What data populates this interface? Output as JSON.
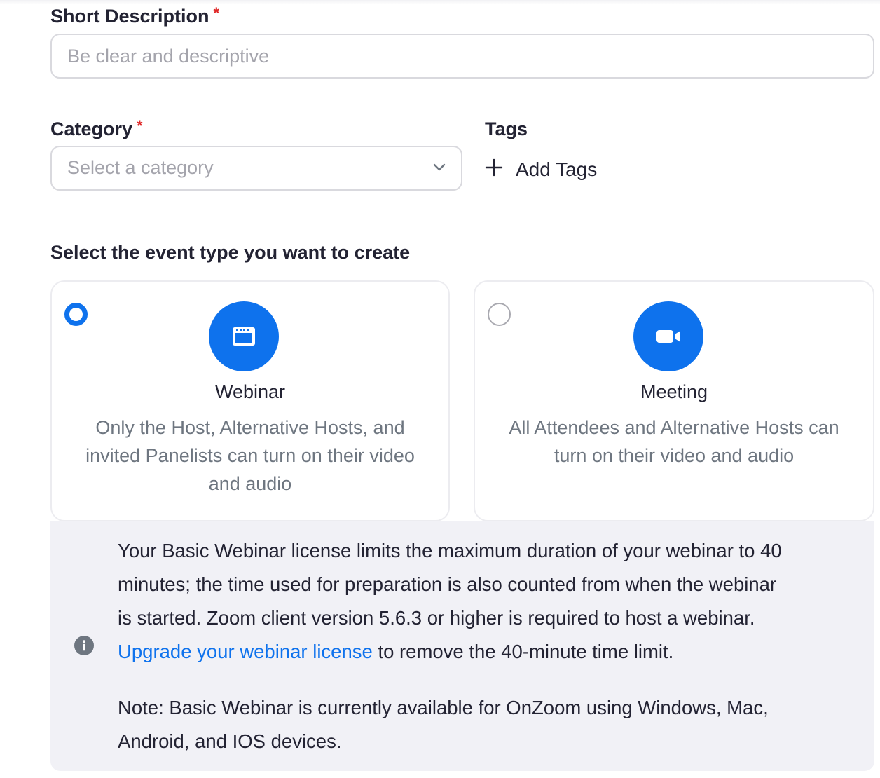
{
  "short_description": {
    "label": "Short Description",
    "required_mark": "*",
    "placeholder": "Be clear and descriptive",
    "value": ""
  },
  "category": {
    "label": "Category",
    "required_mark": "*",
    "placeholder": "Select a category",
    "icon": "chevron-down-icon"
  },
  "tags": {
    "label": "Tags",
    "add_label": "Add Tags",
    "icon": "plus-icon"
  },
  "event_type": {
    "heading": "Select the event type you want to create",
    "options": [
      {
        "title": "Webinar",
        "description_lines": [
          "Only the Host, Alternative Hosts, and",
          "invited Panelists can turn on their video",
          "and audio"
        ],
        "selected": true,
        "icon": "webinar-icon"
      },
      {
        "title": "Meeting",
        "description_lines": [
          "All Attendees and Alternative Hosts can",
          "turn on their video and audio"
        ],
        "selected": false,
        "icon": "video-camera-icon"
      }
    ]
  },
  "notice": {
    "icon": "info-icon",
    "lines": [
      "Your Basic Webinar license limits the maximum duration of your webinar to 40",
      "minutes; the time used for preparation is also counted from when the webinar",
      "is started. Zoom client version 5.6.3 or higher is required to host a webinar."
    ],
    "link_text": "Upgrade your webinar license",
    "after_link": " to remove the 40-minute time limit.",
    "note_lines": [
      "Note: Basic Webinar is currently available for OnZoom using Windows, Mac,",
      "Android, and IOS devices."
    ]
  },
  "colors": {
    "accent": "#0e72ed",
    "required": "#e02828",
    "notice_bg": "#f1f1f6",
    "placeholder": "#a4a4ac"
  }
}
